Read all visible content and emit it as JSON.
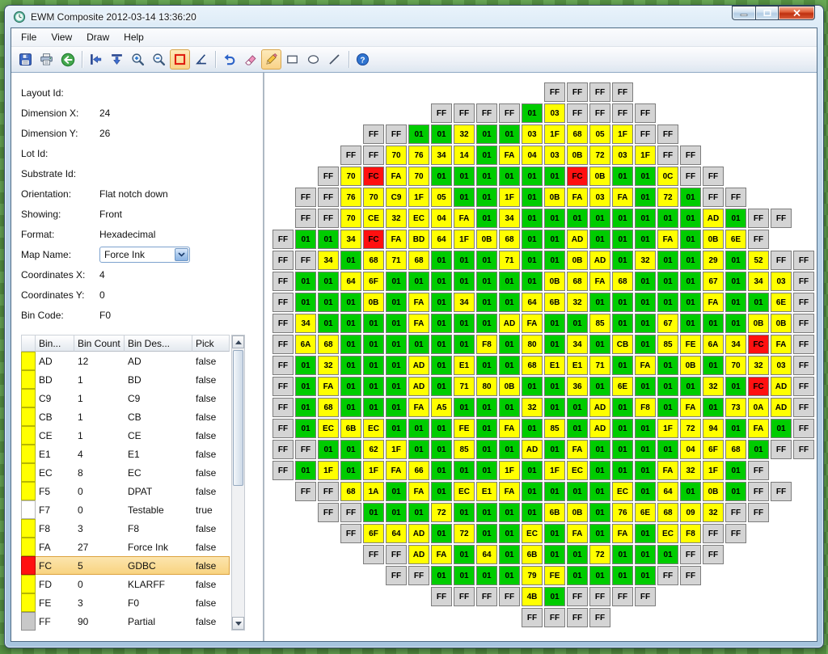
{
  "window": {
    "title": "EWM Composite 2012-03-14 13:36:20"
  },
  "menu": {
    "items": [
      "File",
      "View",
      "Draw",
      "Help"
    ]
  },
  "toolbar": {
    "items": [
      {
        "button": "save-button",
        "icon": "save-icon"
      },
      {
        "button": "print-button",
        "icon": "print-icon"
      },
      {
        "button": "back-button",
        "icon": "back-arrow-icon"
      },
      {
        "separator": true
      },
      {
        "button": "flip-horizontal-button",
        "icon": "flip-horizontal-icon"
      },
      {
        "button": "flip-vertical-button",
        "icon": "flip-vertical-icon"
      },
      {
        "button": "zoom-in-button",
        "icon": "zoom-in-icon"
      },
      {
        "button": "zoom-out-button",
        "icon": "zoom-out-icon"
      },
      {
        "button": "select-region-button",
        "icon": "red-rectangle-icon",
        "selected": true
      },
      {
        "button": "measure-angle-button",
        "icon": "angle-icon"
      },
      {
        "separator": true
      },
      {
        "button": "undo-button",
        "icon": "undo-icon"
      },
      {
        "button": "eraser-button",
        "icon": "eraser-icon"
      },
      {
        "button": "pencil-button",
        "icon": "pencil-icon",
        "selected": true
      },
      {
        "button": "draw-rectangle-button",
        "icon": "rectangle-icon"
      },
      {
        "button": "draw-ellipse-button",
        "icon": "ellipse-icon"
      },
      {
        "button": "draw-line-button",
        "icon": "line-icon"
      },
      {
        "separator": true
      },
      {
        "button": "help-button",
        "icon": "help-icon"
      }
    ]
  },
  "info": {
    "fields_top": [
      {
        "label": "Layout Id:",
        "value": ""
      },
      {
        "label": "Dimension X:",
        "value": "24"
      },
      {
        "label": "Dimension Y:",
        "value": "26"
      },
      {
        "label": "Lot Id:",
        "value": ""
      },
      {
        "label": "Substrate Id:",
        "value": ""
      },
      {
        "label": "Orientation:",
        "value": "Flat notch down"
      },
      {
        "label": "Showing:",
        "value": "Front"
      },
      {
        "label": "Format:",
        "value": "Hexadecimal"
      }
    ],
    "map_name": {
      "label": "Map Name:",
      "value": "Force Ink"
    },
    "fields_bottom": [
      {
        "label": "Coordinates X:",
        "value": "4"
      },
      {
        "label": "Coordinates Y:",
        "value": "0"
      },
      {
        "label": "Bin Code:",
        "value": "F0"
      }
    ]
  },
  "bin_table": {
    "headers": [
      "Bin...",
      "Bin Count",
      "Bin Des...",
      "Pick"
    ],
    "rows": [
      {
        "bin": "AD",
        "count": "12",
        "desc": "AD",
        "pick": "false",
        "color": "#ffff00"
      },
      {
        "bin": "BD",
        "count": "1",
        "desc": "BD",
        "pick": "false",
        "color": "#ffff00"
      },
      {
        "bin": "C9",
        "count": "1",
        "desc": "C9",
        "pick": "false",
        "color": "#ffff00"
      },
      {
        "bin": "CB",
        "count": "1",
        "desc": "CB",
        "pick": "false",
        "color": "#ffff00"
      },
      {
        "bin": "CE",
        "count": "1",
        "desc": "CE",
        "pick": "false",
        "color": "#ffff00"
      },
      {
        "bin": "E1",
        "count": "4",
        "desc": "E1",
        "pick": "false",
        "color": "#ffff00"
      },
      {
        "bin": "EC",
        "count": "8",
        "desc": "EC",
        "pick": "false",
        "color": "#ffff00"
      },
      {
        "bin": "F5",
        "count": "0",
        "desc": "DPAT",
        "pick": "false",
        "color": "#ffff00"
      },
      {
        "bin": "F7",
        "count": "0",
        "desc": "Testable",
        "pick": "true",
        "color": "#ffffff"
      },
      {
        "bin": "F8",
        "count": "3",
        "desc": "F8",
        "pick": "false",
        "color": "#ffff00"
      },
      {
        "bin": "FA",
        "count": "27",
        "desc": "Force Ink",
        "pick": "false",
        "color": "#ffff00"
      },
      {
        "bin": "FC",
        "count": "5",
        "desc": "GDBC",
        "pick": "false",
        "color": "#ff1010",
        "selected": true
      },
      {
        "bin": "FD",
        "count": "0",
        "desc": "KLARFF",
        "pick": "false",
        "color": "#ffff00"
      },
      {
        "bin": "FE",
        "count": "3",
        "desc": "F0",
        "pick": "false",
        "color": "#ffff00"
      },
      {
        "bin": "FF",
        "count": "90",
        "desc": "Partial",
        "pick": "false",
        "color": "#c8c8c8"
      }
    ]
  },
  "wafer": {
    "cols": 24,
    "cell_colors": {
      "FF": "#d4d4d4",
      "01": "#00cc00",
      "FC": "#ff1010",
      "default": "#ffff00"
    },
    "rows": [
      {
        "offset": 12,
        "cells": [
          "FF",
          "FF",
          "FF",
          "FF"
        ]
      },
      {
        "offset": 7,
        "cells": [
          "FF",
          "FF",
          "FF",
          "FF",
          "01",
          "03",
          "FF",
          "FF",
          "FF",
          "FF"
        ]
      },
      {
        "offset": 4,
        "cells": [
          "FF",
          "FF",
          "01",
          "01",
          "32",
          "01",
          "01",
          "03",
          "1F",
          "68",
          "05",
          "1F",
          "FF",
          "FF"
        ]
      },
      {
        "offset": 3,
        "cells": [
          "FF",
          "FF",
          "70",
          "76",
          "34",
          "14",
          "01",
          "FA",
          "04",
          "03",
          "0B",
          "72",
          "03",
          "1F",
          "FF",
          "FF"
        ]
      },
      {
        "offset": 2,
        "cells": [
          "FF",
          "70",
          "FC",
          "FA",
          "70",
          "01",
          "01",
          "01",
          "01",
          "01",
          "01",
          "FC",
          "0B",
          "01",
          "01",
          "0C",
          "FF",
          "FF"
        ]
      },
      {
        "offset": 1,
        "cells": [
          "FF",
          "FF",
          "76",
          "70",
          "C9",
          "1F",
          "05",
          "01",
          "01",
          "1F",
          "01",
          "0B",
          "FA",
          "03",
          "FA",
          "01",
          "72",
          "01",
          "FF",
          "FF"
        ]
      },
      {
        "offset": 1,
        "cells": [
          "FF",
          "FF",
          "70",
          "CE",
          "32",
          "EC",
          "04",
          "FA",
          "01",
          "34",
          "01",
          "01",
          "01",
          "01",
          "01",
          "01",
          "01",
          "01",
          "AD",
          "01",
          "FF",
          "FF"
        ]
      },
      {
        "offset": 0,
        "cells": [
          "FF",
          "01",
          "01",
          "34",
          "FC",
          "FA",
          "BD",
          "64",
          "1F",
          "0B",
          "68",
          "01",
          "01",
          "AD",
          "01",
          "01",
          "01",
          "FA",
          "01",
          "0B",
          "6E",
          "FF"
        ]
      },
      {
        "offset": 0,
        "cells": [
          "FF",
          "FF",
          "34",
          "01",
          "68",
          "71",
          "68",
          "01",
          "01",
          "01",
          "71",
          "01",
          "01",
          "0B",
          "AD",
          "01",
          "32",
          "01",
          "01",
          "29",
          "01",
          "52",
          "FF",
          "FF"
        ]
      },
      {
        "offset": 0,
        "cells": [
          "FF",
          "01",
          "01",
          "64",
          "6F",
          "01",
          "01",
          "01",
          "01",
          "01",
          "01",
          "01",
          "0B",
          "68",
          "FA",
          "68",
          "01",
          "01",
          "01",
          "67",
          "01",
          "34",
          "03",
          "FF"
        ]
      },
      {
        "offset": 0,
        "cells": [
          "FF",
          "01",
          "01",
          "01",
          "0B",
          "01",
          "FA",
          "01",
          "34",
          "01",
          "01",
          "64",
          "6B",
          "32",
          "01",
          "01",
          "01",
          "01",
          "01",
          "FA",
          "01",
          "01",
          "6E",
          "FF"
        ]
      },
      {
        "offset": 0,
        "cells": [
          "FF",
          "34",
          "01",
          "01",
          "01",
          "01",
          "FA",
          "01",
          "01",
          "01",
          "AD",
          "FA",
          "01",
          "01",
          "85",
          "01",
          "01",
          "67",
          "01",
          "01",
          "01",
          "0B",
          "0B",
          "FF"
        ]
      },
      {
        "offset": 0,
        "cells": [
          "FF",
          "6A",
          "68",
          "01",
          "01",
          "01",
          "01",
          "01",
          "01",
          "F8",
          "01",
          "80",
          "01",
          "34",
          "01",
          "CB",
          "01",
          "85",
          "FE",
          "6A",
          "34",
          "FC",
          "FA",
          "FF"
        ]
      },
      {
        "offset": 0,
        "cells": [
          "FF",
          "01",
          "32",
          "01",
          "01",
          "01",
          "AD",
          "01",
          "E1",
          "01",
          "01",
          "68",
          "E1",
          "E1",
          "71",
          "01",
          "FA",
          "01",
          "0B",
          "01",
          "70",
          "32",
          "03",
          "FF"
        ]
      },
      {
        "offset": 0,
        "cells": [
          "FF",
          "01",
          "FA",
          "01",
          "01",
          "01",
          "AD",
          "01",
          "71",
          "80",
          "0B",
          "01",
          "01",
          "36",
          "01",
          "6E",
          "01",
          "01",
          "01",
          "32",
          "01",
          "FC",
          "AD",
          "FF"
        ]
      },
      {
        "offset": 0,
        "cells": [
          "FF",
          "01",
          "68",
          "01",
          "01",
          "01",
          "FA",
          "A5",
          "01",
          "01",
          "01",
          "32",
          "01",
          "01",
          "AD",
          "01",
          "F8",
          "01",
          "FA",
          "01",
          "73",
          "0A",
          "AD",
          "FF"
        ]
      },
      {
        "offset": 0,
        "cells": [
          "FF",
          "01",
          "EC",
          "6B",
          "EC",
          "01",
          "01",
          "01",
          "FE",
          "01",
          "FA",
          "01",
          "85",
          "01",
          "AD",
          "01",
          "01",
          "1F",
          "72",
          "94",
          "01",
          "FA",
          "01",
          "FF"
        ]
      },
      {
        "offset": 0,
        "cells": [
          "FF",
          "FF",
          "01",
          "01",
          "62",
          "1F",
          "01",
          "01",
          "85",
          "01",
          "01",
          "AD",
          "01",
          "FA",
          "01",
          "01",
          "01",
          "01",
          "04",
          "6F",
          "68",
          "01",
          "FF",
          "FF"
        ]
      },
      {
        "offset": 0,
        "cells": [
          "FF",
          "01",
          "1F",
          "01",
          "1F",
          "FA",
          "66",
          "01",
          "01",
          "01",
          "1F",
          "01",
          "1F",
          "EC",
          "01",
          "01",
          "01",
          "FA",
          "32",
          "1F",
          "01",
          "FF"
        ]
      },
      {
        "offset": 1,
        "cells": [
          "FF",
          "FF",
          "68",
          "1A",
          "01",
          "FA",
          "01",
          "EC",
          "E1",
          "FA",
          "01",
          "01",
          "01",
          "01",
          "EC",
          "01",
          "64",
          "01",
          "0B",
          "01",
          "FF",
          "FF"
        ]
      },
      {
        "offset": 2,
        "cells": [
          "FF",
          "FF",
          "01",
          "01",
          "01",
          "72",
          "01",
          "01",
          "01",
          "01",
          "6B",
          "0B",
          "01",
          "76",
          "6E",
          "68",
          "09",
          "32",
          "FF",
          "FF"
        ]
      },
      {
        "offset": 3,
        "cells": [
          "FF",
          "6F",
          "64",
          "AD",
          "01",
          "72",
          "01",
          "01",
          "EC",
          "01",
          "FA",
          "01",
          "FA",
          "01",
          "EC",
          "F8",
          "FF",
          "FF"
        ]
      },
      {
        "offset": 4,
        "cells": [
          "FF",
          "FF",
          "AD",
          "FA",
          "01",
          "64",
          "01",
          "6B",
          "01",
          "01",
          "72",
          "01",
          "01",
          "01",
          "FF",
          "FF"
        ]
      },
      {
        "offset": 5,
        "cells": [
          "FF",
          "FF",
          "01",
          "01",
          "01",
          "01",
          "79",
          "FE",
          "01",
          "01",
          "01",
          "01",
          "FF",
          "FF"
        ]
      },
      {
        "offset": 7,
        "cells": [
          "FF",
          "FF",
          "FF",
          "FF",
          "4B",
          "01",
          "FF",
          "FF",
          "FF",
          "FF"
        ]
      },
      {
        "offset": 11,
        "cells": [
          "FF",
          "FF",
          "FF",
          "FF"
        ]
      }
    ]
  }
}
